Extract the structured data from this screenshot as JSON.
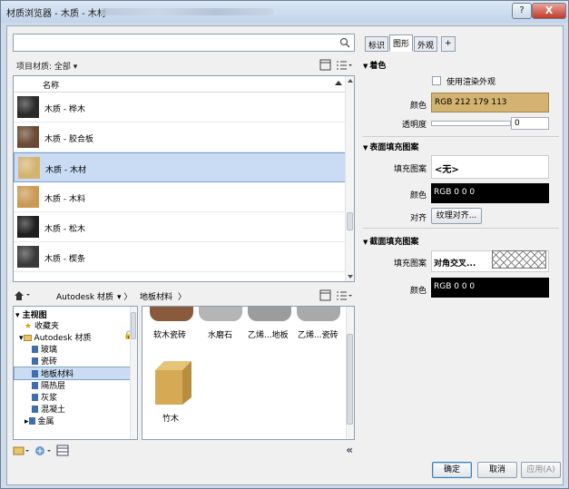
{
  "window": {
    "title": "材质浏览器 - 木质 - 木材",
    "help_label": "?",
    "close_label": "X"
  },
  "left": {
    "search_placeholder": "",
    "filter_label": "项目材质: 全部 ▾",
    "list_header": "名称",
    "materials": [
      {
        "name": "木质 - 桦木",
        "swatch": "#2a2a2a"
      },
      {
        "name": "木质 - 胶合板",
        "swatch": "#6b4a33"
      },
      {
        "name": "木质 - 木材",
        "swatch": "#d4b371",
        "selected": true
      },
      {
        "name": "木质 - 木料",
        "swatch": "#c99a55"
      },
      {
        "name": "木质 - 松木",
        "swatch": "#1e1e1e"
      },
      {
        "name": "木质 - 楔条",
        "swatch": "#3a3a3a"
      }
    ],
    "library_breadcrumb": [
      "Autodesk 材质",
      "地板材料"
    ],
    "tree": {
      "root": "主视图",
      "favorites": "收藏夹",
      "autodesk": "Autodesk 材质",
      "children": [
        "玻璃",
        "瓷砖",
        "地板材料",
        "隔热层",
        "灰浆",
        "混凝土",
        "金属"
      ]
    },
    "gallery": {
      "top_tiles": [
        "软木瓷砖",
        "水磨石",
        "乙烯...地板",
        "乙烯...瓷砖"
      ],
      "tile": "竹木"
    }
  },
  "right": {
    "tabs": [
      "标识",
      "图形",
      "外观",
      "+"
    ],
    "active_tab": "图形",
    "shading": {
      "header": "着色",
      "use_render_label": "使用渲染外观",
      "color_label": "颜色",
      "color_value": "RGB 212 179 113",
      "color_hex": "#d4b371",
      "transparency_label": "透明度",
      "transparency_value": "0"
    },
    "surface": {
      "header": "表面填充图案",
      "pattern_label": "填充图案",
      "pattern_value": "<无>",
      "color_label": "颜色",
      "color_value": "RGB 0 0 0",
      "align_label": "对齐",
      "align_button": "纹理对齐..."
    },
    "cut": {
      "header": "截面填充图案",
      "pattern_label": "填充图案",
      "pattern_value": "对角交叉...",
      "color_label": "颜色",
      "color_value": "RGB 0 0 0"
    }
  },
  "footer": {
    "ok": "确定",
    "cancel": "取消",
    "apply": "应用(A)"
  }
}
